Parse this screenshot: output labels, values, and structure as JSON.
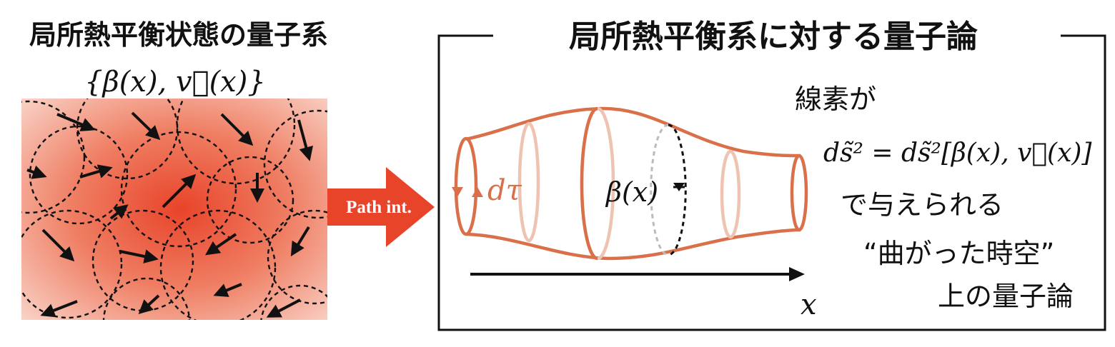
{
  "left_panel": {
    "title": "局所熱平衡状態の量子系",
    "math_label": "{β(x), v⃗(x)}"
  },
  "arrow": {
    "label": "Path int.",
    "color": "#e8442a"
  },
  "right_panel": {
    "title": "局所熱平衡系に対する量子論",
    "tube_labels": {
      "d_tau": "dτ",
      "beta": "β(x)"
    },
    "axis_label": "x",
    "explanation": {
      "line1": "線素が",
      "line2": "ds̃² = ds̃²[β(x), v⃗(x)]",
      "line3": "で与えられる",
      "line4": "“曲がった時空”",
      "line5": "上の量子論"
    }
  },
  "colors": {
    "accent": "#e8442a",
    "tube": "#d9704a",
    "tube_faint": "#efc3b2",
    "text": "#111111"
  }
}
